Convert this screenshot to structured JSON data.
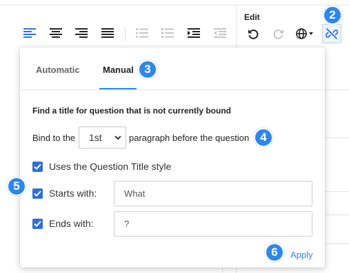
{
  "toolbar": {
    "edit_group_label": "Edit",
    "format_buttons": [
      "align-left-icon",
      "align-center-icon",
      "align-right-icon",
      "justify-icon",
      "bulleted-list-icon",
      "numbered-list-icon",
      "indent-icon",
      "outdent-icon"
    ],
    "edit_buttons": [
      "undo-icon",
      "redo-icon",
      "language-icon",
      "unlink-icon"
    ],
    "accent_color": "#2f86eb"
  },
  "callouts": {
    "c2": "2",
    "c3": "3",
    "c4": "4",
    "c5": "5",
    "c6": "6"
  },
  "panel": {
    "tabs": [
      {
        "label": "Automatic",
        "active": false
      },
      {
        "label": "Manual",
        "active": true
      }
    ],
    "heading": "Find a title for question that is not currently bound",
    "bind_prefix": "Bind to the",
    "paragraph_select": {
      "value": "1st"
    },
    "bind_suffix": "paragraph before the question",
    "options": {
      "uses_title_style": {
        "label": "Uses the Question Title style",
        "checked": true
      },
      "starts_with": {
        "label": "Starts with:",
        "checked": true,
        "value": "What"
      },
      "ends_with": {
        "label": "Ends with:",
        "checked": true,
        "value": "?"
      }
    },
    "apply_label": "Apply"
  }
}
